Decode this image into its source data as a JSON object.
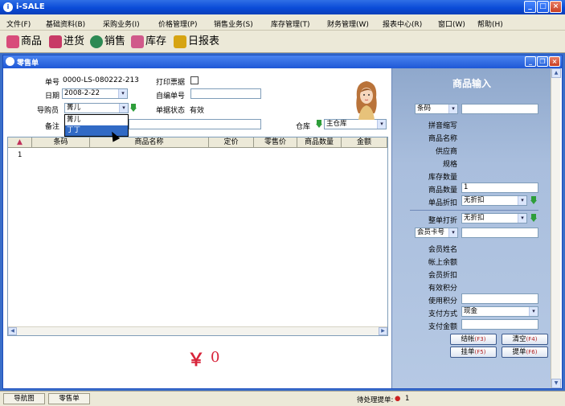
{
  "app": {
    "title": "i-SALE"
  },
  "menu": [
    "文件(F)",
    "基础资料(B)",
    "采购业务(I)",
    "价格管理(P)",
    "销售业务(S)",
    "库存管理(T)",
    "财务管理(W)",
    "报表中心(R)",
    "窗口(W)",
    "帮助(H)"
  ],
  "toolbar": [
    {
      "label": "商品",
      "icon": "goods-icon",
      "color": "#d84b7a"
    },
    {
      "label": "进货",
      "icon": "purchase-icon",
      "color": "#c83a66"
    },
    {
      "label": "销售",
      "icon": "sales-globe-icon",
      "color": "#2d8a54"
    },
    {
      "label": "库存",
      "icon": "inventory-icon",
      "color": "#d05a8a"
    },
    {
      "label": "日报表",
      "icon": "daily-report-icon",
      "color": "#d6a412"
    }
  ],
  "window": {
    "title": "零售单"
  },
  "form": {
    "order_no_label": "单号",
    "order_no": "0000-LS-080222-213",
    "print_label": "打印票据",
    "date_label": "日期",
    "date": "2008-2-22",
    "custom_no_label": "自编单号",
    "custom_no": "",
    "buyer_label": "导购员",
    "buyer": "菁儿",
    "status_label": "单据状态",
    "status": "有效",
    "remark_label": "备注",
    "remark": "",
    "warehouse_label": "仓库",
    "warehouse": "主仓库"
  },
  "buyer_options": [
    "菁儿",
    "丁丁"
  ],
  "grid": {
    "columns": [
      "条码",
      "商品名称",
      "定价",
      "零售价",
      "商品数量",
      "金额"
    ],
    "rows": [
      "1"
    ]
  },
  "total": {
    "symbol": "￥",
    "amount": "0"
  },
  "panel": {
    "title": "商品输入",
    "barcode_select": "条码",
    "fields": [
      {
        "label": "拼音缩写",
        "value": ""
      },
      {
        "label": "商品名称",
        "value": ""
      },
      {
        "label": "供应商",
        "value": ""
      },
      {
        "label": "规格",
        "value": ""
      },
      {
        "label": "库存数量",
        "value": ""
      }
    ],
    "qty_label": "商品数量",
    "qty": "1",
    "discount_label": "单品折扣",
    "discount": "无折扣",
    "order_discount_label": "整单打折",
    "order_discount": "无折扣",
    "member_select": "会员卡号",
    "member_fields": [
      {
        "label": "会员姓名"
      },
      {
        "label": "帐上余额"
      },
      {
        "label": "会员折扣"
      },
      {
        "label": "有效积分"
      }
    ],
    "points_label": "使用积分",
    "points": "",
    "payment_label": "支付方式",
    "payment": "现金",
    "pay_amount_label": "支付金额",
    "pay_amount": "",
    "buttons": [
      {
        "label": "结帐",
        "key": "(F3)"
      },
      {
        "label": "清空",
        "key": "(F4)"
      },
      {
        "label": "挂单",
        "key": "(F5)"
      },
      {
        "label": "提单",
        "key": "(F6)"
      }
    ]
  },
  "statusbar": {
    "tabs": [
      "导航图",
      "零售单"
    ],
    "pending_label": "待处理提单:",
    "pending_count": "1"
  }
}
